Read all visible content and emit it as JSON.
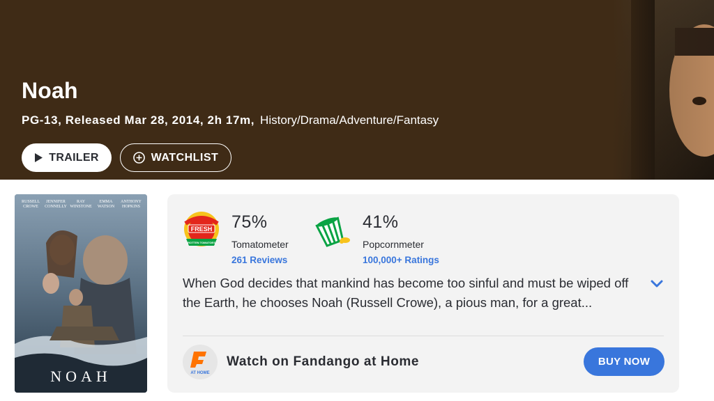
{
  "movie": {
    "title": "Noah",
    "meta_bold": "PG-13, Released Mar 28, 2014, 2h 17m,",
    "genres": "History/Drama/Adventure/Fantasy"
  },
  "actions": {
    "trailer_label": "TRAILER",
    "watchlist_label": "WATCHLIST"
  },
  "poster": {
    "title": "NOAH",
    "credits": [
      {
        "first": "RUSSELL",
        "last": "CROWE"
      },
      {
        "first": "JENNIFER",
        "last": "CONNELLY"
      },
      {
        "first": "RAY",
        "last": "WINSTONE"
      },
      {
        "first": "EMMA",
        "last": "WATSON"
      },
      {
        "first": "ANTHONY",
        "last": "HOPKINS"
      }
    ]
  },
  "scores": {
    "tomatometer": {
      "value": "75%",
      "label": "Tomatometer",
      "reviews": "261 Reviews",
      "badge": "Certified Fresh",
      "icon": "certified-fresh-icon"
    },
    "popcornmeter": {
      "value": "41%",
      "label": "Popcornmeter",
      "ratings": "100,000+ Ratings",
      "icon": "spilled-popcorn-icon"
    }
  },
  "synopsis": "When God decides that mankind has become too sinful and must be wiped off the Earth, he chooses Noah (Russell Crowe), a pious man, for a great...",
  "fandango": {
    "label": "Watch on Fandango at Home",
    "logo_letter": "F",
    "logo_caption": "AT HOME",
    "buy_label": "BUY NOW"
  },
  "colors": {
    "hero_background": "#3f2b16",
    "accent_blue": "#3976dc",
    "card_background": "#f3f3f3",
    "fresh_red": "#e3261b",
    "popcorn_green": "#0aa344"
  }
}
